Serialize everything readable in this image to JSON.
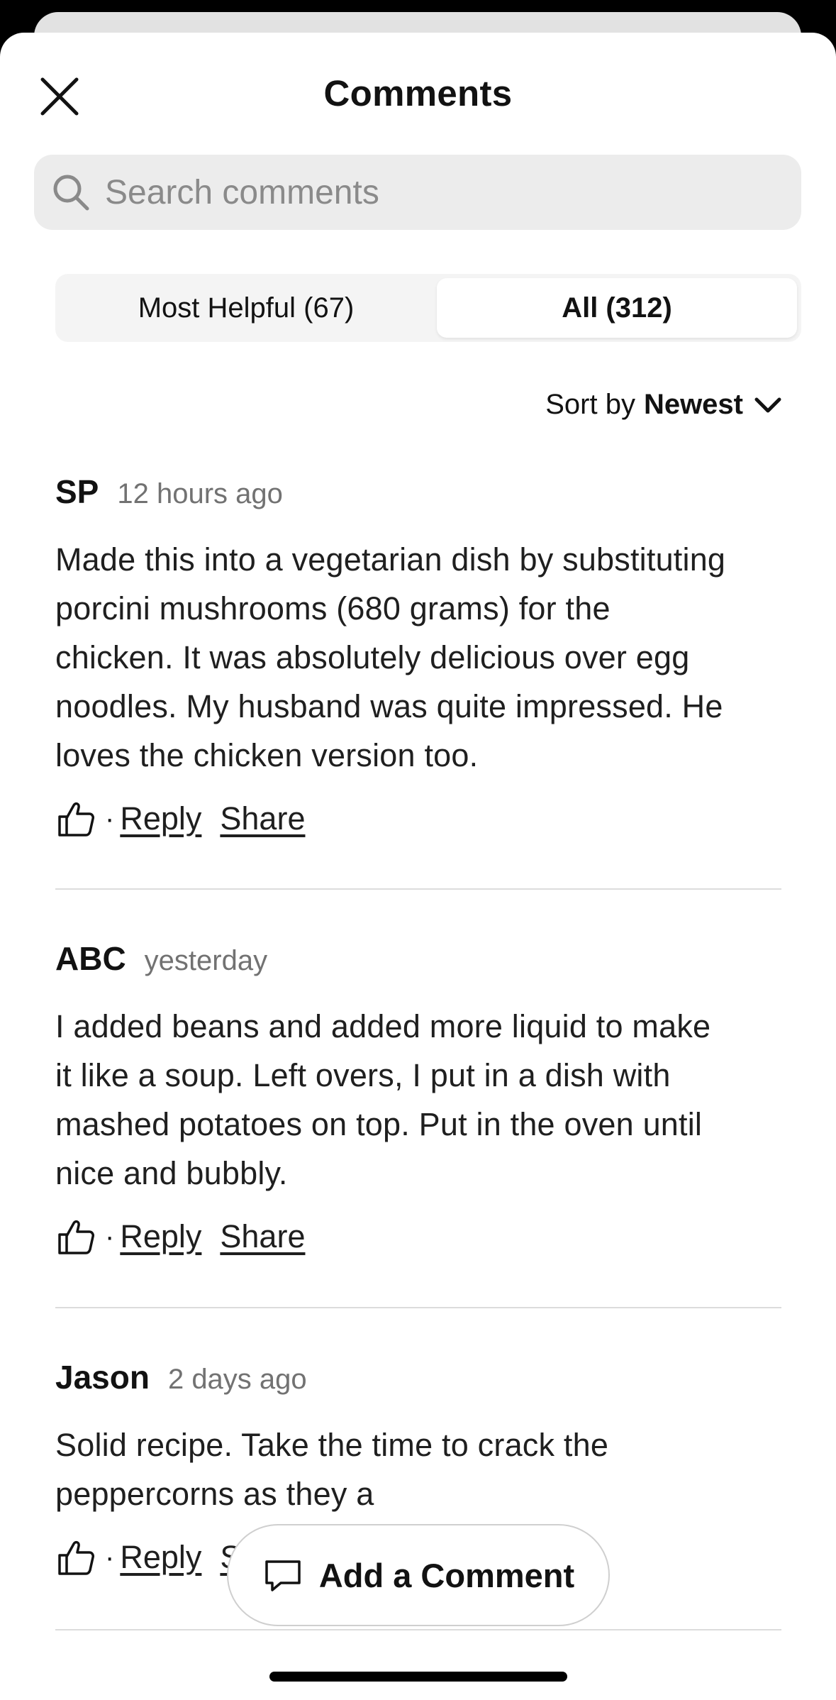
{
  "header": {
    "title": "Comments",
    "close_icon": "close-icon"
  },
  "search": {
    "placeholder": "Search comments",
    "value": "",
    "icon": "search-icon"
  },
  "tabs": [
    {
      "label": "Most Helpful (67)",
      "selected": false
    },
    {
      "label": "All (312)",
      "selected": true
    }
  ],
  "sort": {
    "label": "Sort by",
    "value": "Newest",
    "icon": "chevron-down-icon"
  },
  "comments": [
    {
      "author": "SP",
      "time": "12 hours ago",
      "lines": [
        "Made this into a vegetarian dish by substituting",
        "porcini mushrooms (680 grams) for the",
        "chicken. It was absolutely delicious over egg",
        "noodles. My husband was quite impressed. He",
        "loves the chicken version too."
      ],
      "reply": "Reply",
      "share": "Share"
    },
    {
      "author": "ABC",
      "time": "yesterday",
      "lines": [
        "I added beans and added more liquid to make",
        "it like a soup. Left overs, I put in a dish with",
        "mashed potatoes on top. Put in the oven until",
        "nice and bubbly."
      ],
      "reply": "Reply",
      "share": "Share"
    },
    {
      "author": "Jason",
      "time": "2 days ago",
      "lines": [
        "Solid recipe. Take the time to crack the",
        "peppercorns as they a"
      ],
      "reply": "Reply",
      "share": "Share"
    }
  ],
  "actions": {
    "dot": "·"
  },
  "add_comment": {
    "label": "Add a Comment",
    "icon": "comment-bubble-icon"
  },
  "colors": {
    "background": "#ffffff",
    "search_bg": "#ececec",
    "muted_text": "#727272",
    "divider": "#dcdcdc"
  }
}
